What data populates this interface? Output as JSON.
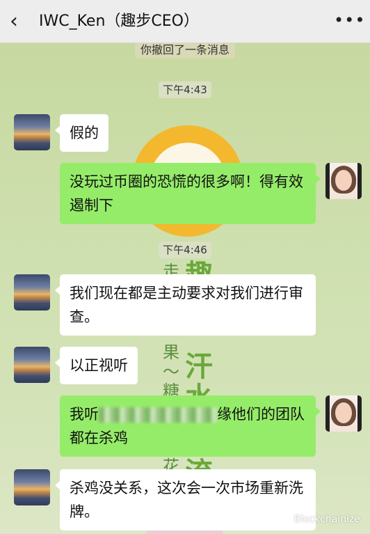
{
  "header": {
    "back_icon": "chevron-left-icon",
    "title": "IWC_Ken（趣步CEO）",
    "more_icon": "more-icon"
  },
  "system": {
    "recall_notice": "你撤回了一条消息"
  },
  "timestamps": [
    "下午4:43",
    "下午4:46"
  ],
  "wallpaper": {
    "big_chars": [
      "趣",
      "汗",
      "水",
      "流"
    ],
    "small_chars": [
      "走",
      "果",
      "〜",
      "糖",
      "花"
    ]
  },
  "messages": [
    {
      "side": "in",
      "text": "假的"
    },
    {
      "side": "out",
      "text": "没玩过币圈的恐慌的很多啊！得有效遏制下"
    },
    {
      "side": "in",
      "text": "我们现在都是主动要求对我们进行审查。"
    },
    {
      "side": "in",
      "text": "以正视听"
    },
    {
      "side": "out",
      "text_start": "我听",
      "text_end": "缘他们的团队都在杀鸡"
    },
    {
      "side": "in",
      "text": "杀鸡没关系，这次会一次市场重新洗牌。"
    }
  ],
  "watermark": "Blockchainize",
  "colors": {
    "bubble_out": "#95ec69",
    "bubble_in": "#ffffff",
    "header_bg": "#ededed"
  }
}
